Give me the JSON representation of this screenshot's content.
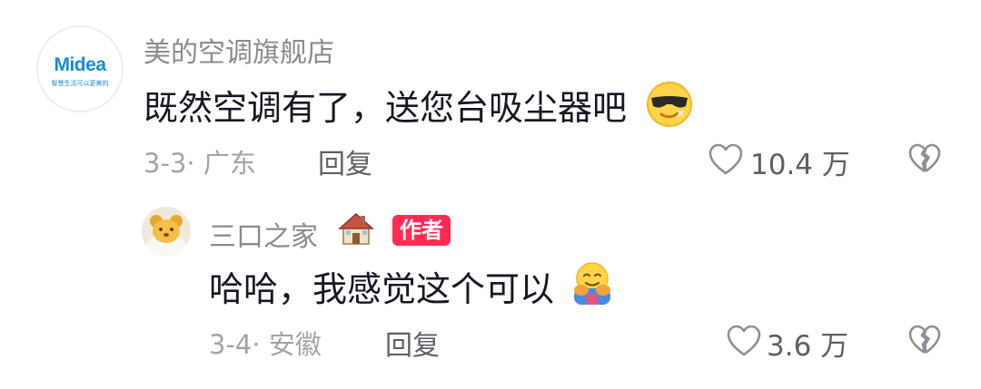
{
  "comments": [
    {
      "username": "美的空调旗舰店",
      "avatar_logo_text": "Midea",
      "avatar_tagline": "智慧生活可以更美的",
      "text": "既然空调有了，送您台吸尘器吧",
      "emoji": "cool-face-emoji",
      "date": "3-3",
      "location": "广东",
      "reply_label": "回复",
      "like_count": "10.4 万"
    },
    {
      "username": "三口之家",
      "username_emoji": "house-emoji",
      "badge": "作者",
      "text": "哈哈，我感觉这个可以",
      "emoji": "hug-emoji",
      "date": "3-4",
      "location": "安徽",
      "reply_label": "回复",
      "like_count": "3.6 万"
    }
  ],
  "icons": {
    "like": "heart-outline-icon",
    "dislike": "broken-heart-icon"
  },
  "colors": {
    "badge": "#fe2c55",
    "brand_blue": "#1a8ad6",
    "secondary_text": "#8a8b91"
  }
}
